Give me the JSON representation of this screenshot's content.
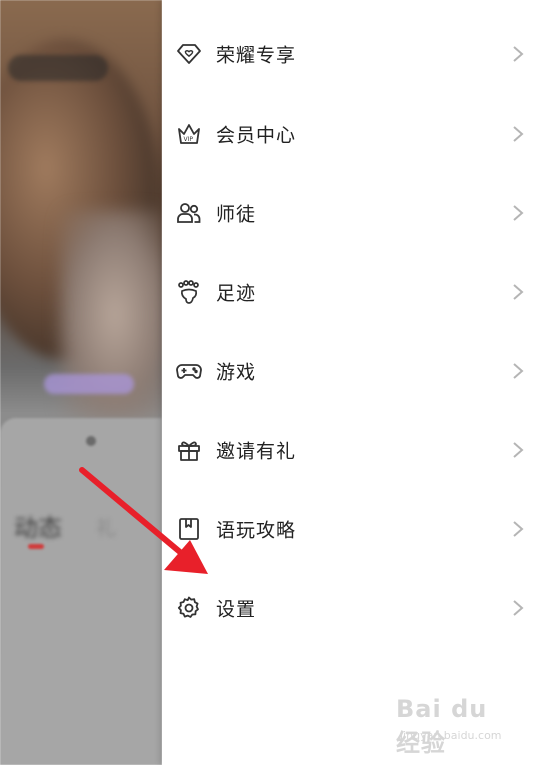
{
  "menu": {
    "items": [
      {
        "label": "荣耀专享",
        "icon": "diamond-heart-icon"
      },
      {
        "label": "会员中心",
        "icon": "vip-crown-icon"
      },
      {
        "label": "师徒",
        "icon": "people-icon"
      },
      {
        "label": "足迹",
        "icon": "footprint-icon"
      },
      {
        "label": "游戏",
        "icon": "gamepad-icon"
      },
      {
        "label": "邀请有礼",
        "icon": "gift-icon"
      },
      {
        "label": "语玩攻略",
        "icon": "guide-book-icon"
      },
      {
        "label": "设置",
        "icon": "gear-icon"
      }
    ]
  },
  "background": {
    "tab_active": "动态",
    "tab_inactive": "礼"
  },
  "watermark": {
    "main": "Bai du 经验",
    "sub": "jingyan.baidu.com"
  },
  "colors": {
    "text": "#222222",
    "chevron": "#b5b5b5",
    "icon": "#333333",
    "annotation": "#e8202a"
  }
}
